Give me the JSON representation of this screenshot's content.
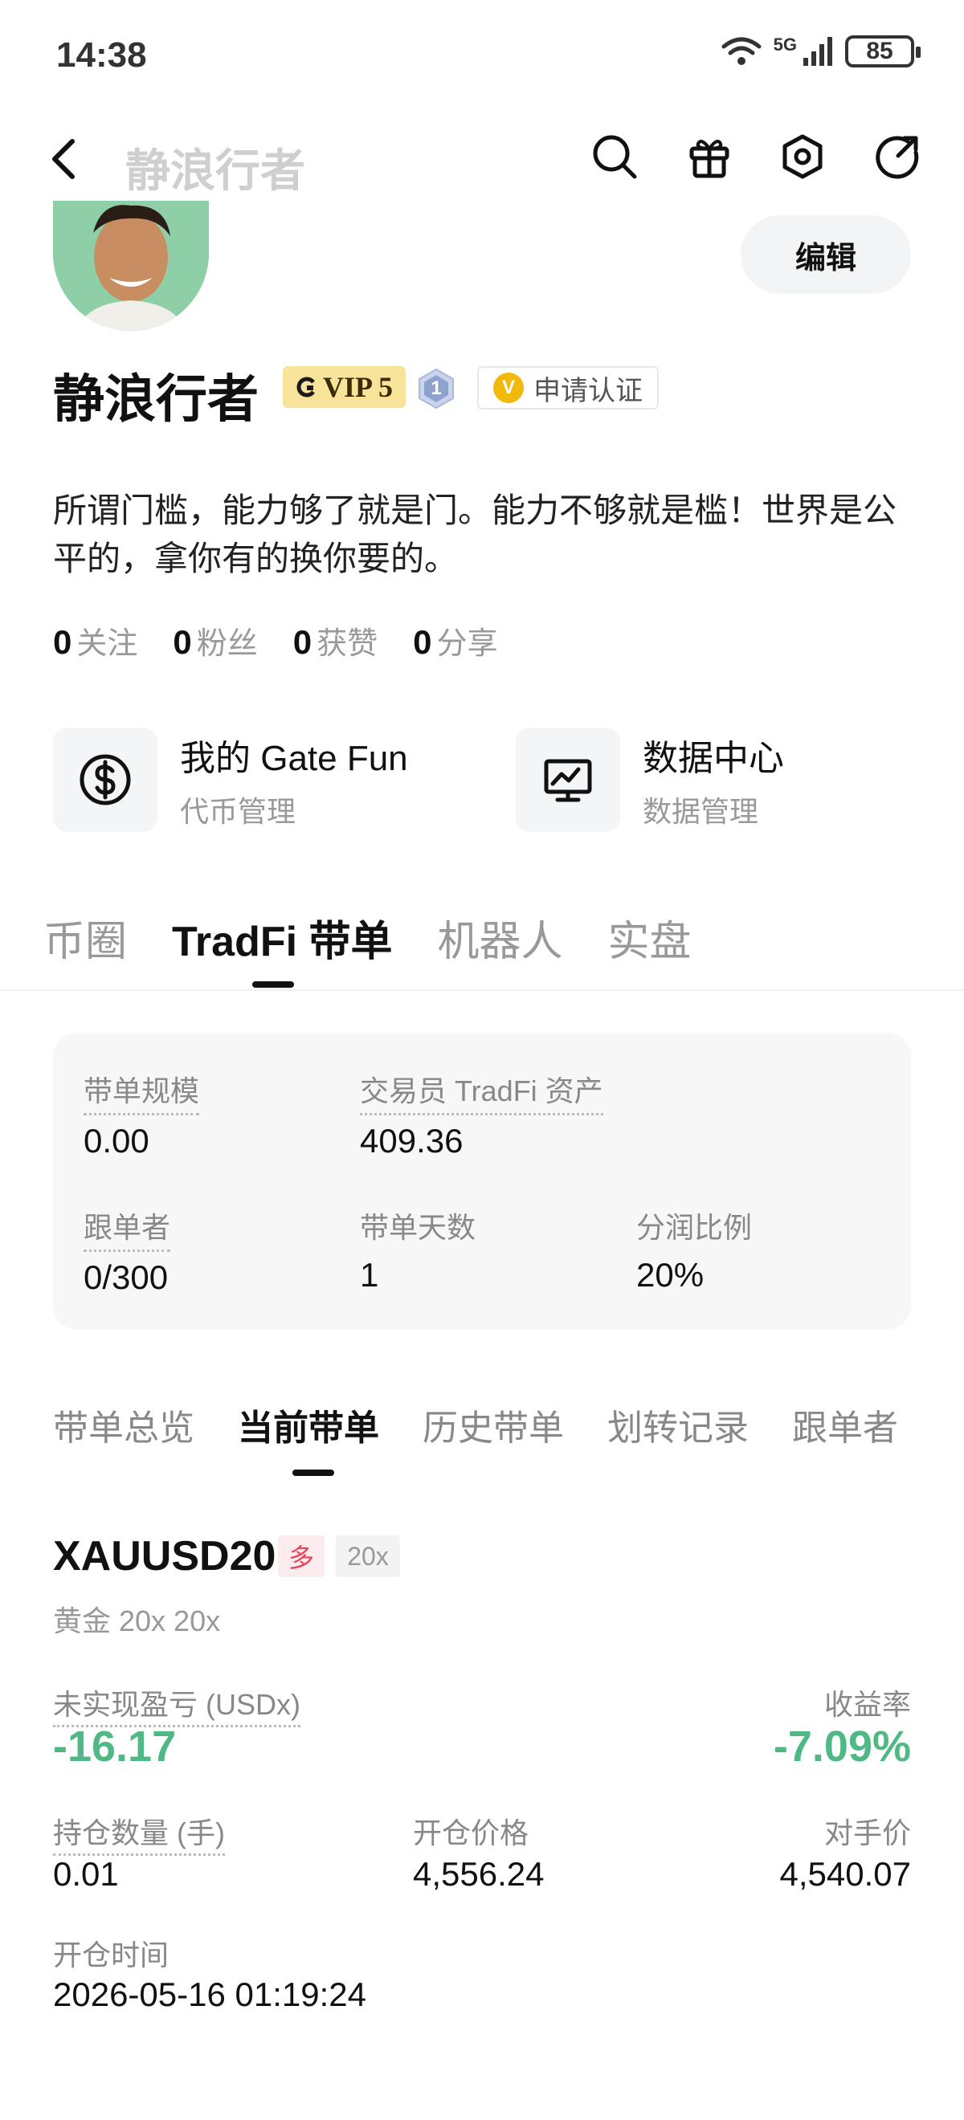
{
  "status_bar": {
    "time": "14:38",
    "network": "5G",
    "battery": "85"
  },
  "header": {
    "title": "静浪行者"
  },
  "profile": {
    "name": "静浪行者",
    "vip": "VIP 5",
    "level": "1",
    "verify_label": "申请认证",
    "edit_label": "编辑",
    "bio": "所谓门槛，能力够了就是门。能力不够就是槛！世界是公平的，拿你有的换你要的。",
    "stats": [
      {
        "count": "0",
        "label": "关注"
      },
      {
        "count": "0",
        "label": "粉丝"
      },
      {
        "count": "0",
        "label": "获赞"
      },
      {
        "count": "0",
        "label": "分享"
      }
    ]
  },
  "quick_links": [
    {
      "title": "我的 Gate Fun",
      "subtitle": "代币管理",
      "icon": "dollar-icon"
    },
    {
      "title": "数据中心",
      "subtitle": "数据管理",
      "icon": "chart-monitor-icon"
    }
  ],
  "main_tabs": [
    "币圈",
    "TradFi 带单",
    "机器人",
    "实盘"
  ],
  "overview": {
    "scale_label": "带单规模",
    "scale_value": "0.00",
    "assets_label": "交易员 TradFi 资产",
    "assets_value": "409.36",
    "followers_label": "跟单者",
    "followers_value": "0/300",
    "days_label": "带单天数",
    "days_value": "1",
    "share_label": "分润比例",
    "share_value": "20%"
  },
  "sub_tabs": [
    "带单总览",
    "当前带单",
    "历史带单",
    "划转记录",
    "跟单者"
  ],
  "position": {
    "symbol": "XAUUSD20",
    "side": "多",
    "leverage": "20x",
    "subtitle": "黄金 20x 20x",
    "pnl_label": "未实现盈亏 (USDx)",
    "pnl_value": "-16.17",
    "roi_label": "收益率",
    "roi_value": "-7.09%",
    "qty_label": "持仓数量 (手)",
    "qty_value": "0.01",
    "open_price_label": "开仓价格",
    "open_price_value": "4,556.24",
    "counter_price_label": "对手价",
    "counter_price_value": "4,540.07",
    "open_time_label": "开仓时间",
    "open_time_value": "2026-05-16 01:19:24"
  },
  "colors": {
    "profit_text": "#4fb884",
    "vip_bg": "#f8e39a",
    "long_tag": "#e8445a"
  }
}
